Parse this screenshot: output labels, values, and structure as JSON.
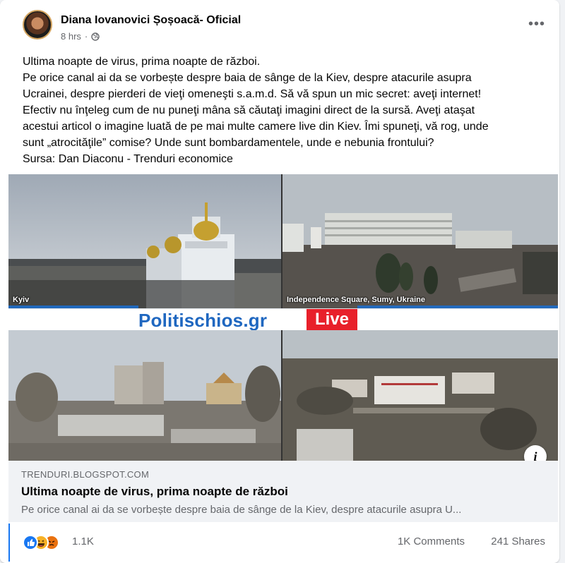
{
  "post": {
    "author": "Diana Iovanovici Șoșoacă- Oficial",
    "time": "8 hrs",
    "privacy_icon": "globe-icon",
    "menu_icon": "more-options-icon",
    "text_lines": [
      "Ultima noapte de virus, prima noapte de război.",
      "Pe orice canal ai da se vorbește despre baia de sânge de la Kiev, despre atacurile asupra",
      "Ucrainei, despre pierderi de vieţi omeneşti s.a.m.d. Să vă spun un mic secret: aveţi internet!",
      "Efectiv nu înţeleg cum de nu puneţi mâna să căutaţi imagini direct de la sursă. Aveţi ataşat",
      "acestui articol o imagine luată de pe mai multe camere live din Kiev. Îmi spuneţi, vă rog, unde",
      "sunt „atrocităţile” comise? Unde sunt bombardamentele, unde e nebunia frontului?",
      "Sursa: Dan Diaconu - Trenduri economice"
    ]
  },
  "image": {
    "cam1_label": "Kyiv",
    "cam2_label": "Independence Square, Sumy, Ukraine",
    "brand": "Politischios.gr",
    "live": "Live"
  },
  "link": {
    "domain": "TRENDURI.BLOGSPOT.COM",
    "title": "Ultima noapte de virus, prima noapte de război",
    "description": "Pe orice canal ai da se vorbește despre baia de sânge de la Kiev, despre atacurile asupra U...",
    "info_icon": "info-icon",
    "info_glyph": "i"
  },
  "stats": {
    "reactions": [
      "like-icon",
      "haha-icon",
      "angry-icon"
    ],
    "reaction_count": "1.1K",
    "comments": "1K Comments",
    "shares": "241 Shares"
  },
  "colors": {
    "brand_blue": "#1f67c0",
    "live_red": "#e8202a",
    "like_blue": "#1877f2"
  }
}
